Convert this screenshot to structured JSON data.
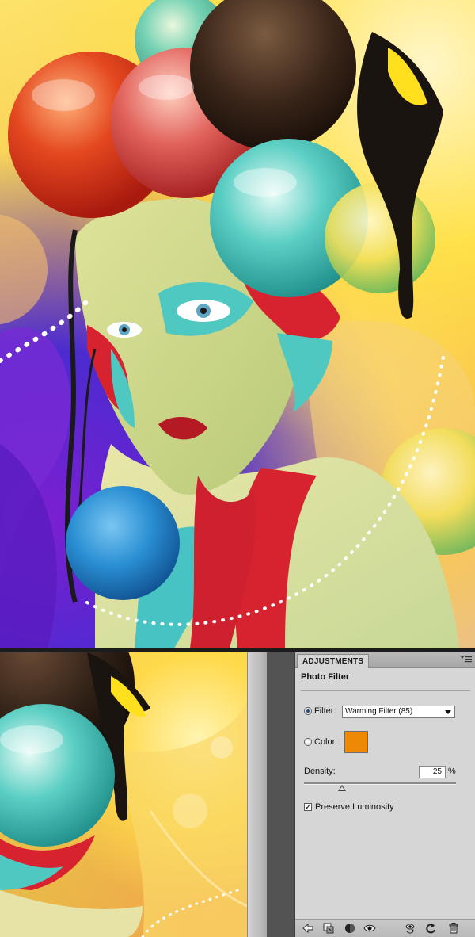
{
  "panel": {
    "tab_label": "ADJUSTMENTS",
    "title": "Photo Filter",
    "filter_label": "Filter:",
    "filter_value": "Warming Filter (85)",
    "color_label": "Color:",
    "color_swatch": "#EE8905",
    "density_label": "Density:",
    "density_value": "25",
    "density_unit": "%",
    "density_fraction": 0.25,
    "preserve_label": "Preserve Luminosity",
    "preserve_checked": true,
    "selected_mode": "filter"
  },
  "footer_icons": [
    "back-arrow-icon",
    "clip-to-layer-icon",
    "mask-icon",
    "visibility-eye-icon",
    "view-previous-state-icon",
    "reset-icon",
    "trash-icon"
  ]
}
